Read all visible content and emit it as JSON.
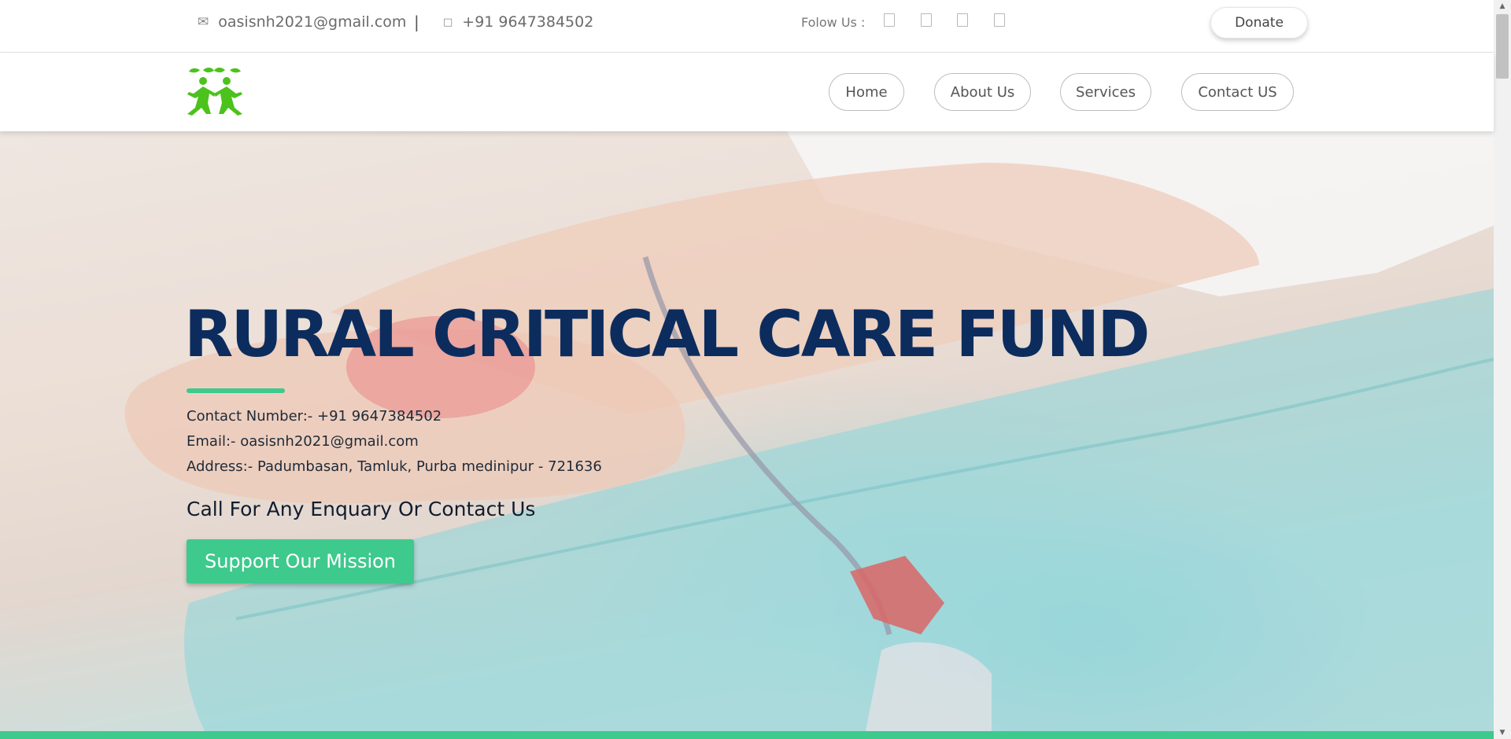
{
  "topbar": {
    "email": "oasisnh2021@gmail.com",
    "separator": "|",
    "phone": "+91 9647384502",
    "follow_label": "Folow Us :",
    "social_icons": [
      "facebook-icon",
      "twitter-icon",
      "instagram-icon",
      "youtube-icon"
    ],
    "donate_label": "Donate"
  },
  "nav": {
    "items": [
      {
        "label": "Home"
      },
      {
        "label": "About Us"
      },
      {
        "label": "Services"
      },
      {
        "label": "Contact US"
      }
    ]
  },
  "hero": {
    "title": "RURAL CRITICAL CARE FUND",
    "contact_line": "Contact Number:- +91 9647384502",
    "email_line": "Email:- oasisnh2021@gmail.com",
    "address_line": "Address:- Padumbasan, Tamluk, Purba medinipur - 721636",
    "enquiry": "Call For Any Enquary Or Contact Us",
    "cta_label": "Support Our Mission"
  },
  "colors": {
    "accent": "#3ec98d",
    "title": "#0c2c5e",
    "logo": "#4cc21d"
  }
}
